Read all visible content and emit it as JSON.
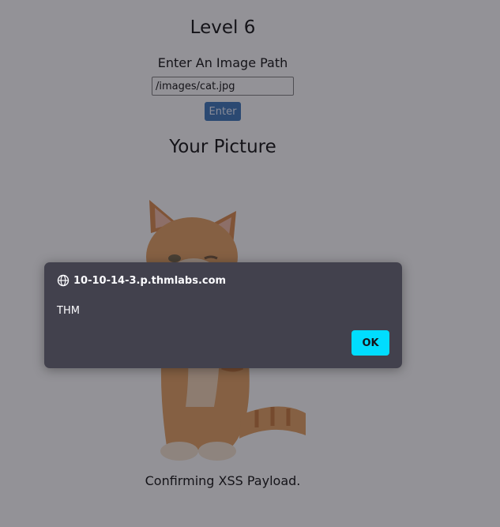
{
  "page": {
    "title": "Level 6",
    "prompt": "Enter An Image Path",
    "path_input": {
      "value": "/images/cat.jpg"
    },
    "enter_label": "Enter",
    "picture_heading": "Your Picture",
    "picture_icon": "kitten-photo",
    "caption": "Confirming XSS Payload."
  },
  "alert": {
    "origin_icon": "globe-icon",
    "origin": "10-10-14-3.p.thmlabs.com",
    "message": "THM",
    "ok_label": "OK",
    "accent_color": "#00ddff"
  }
}
